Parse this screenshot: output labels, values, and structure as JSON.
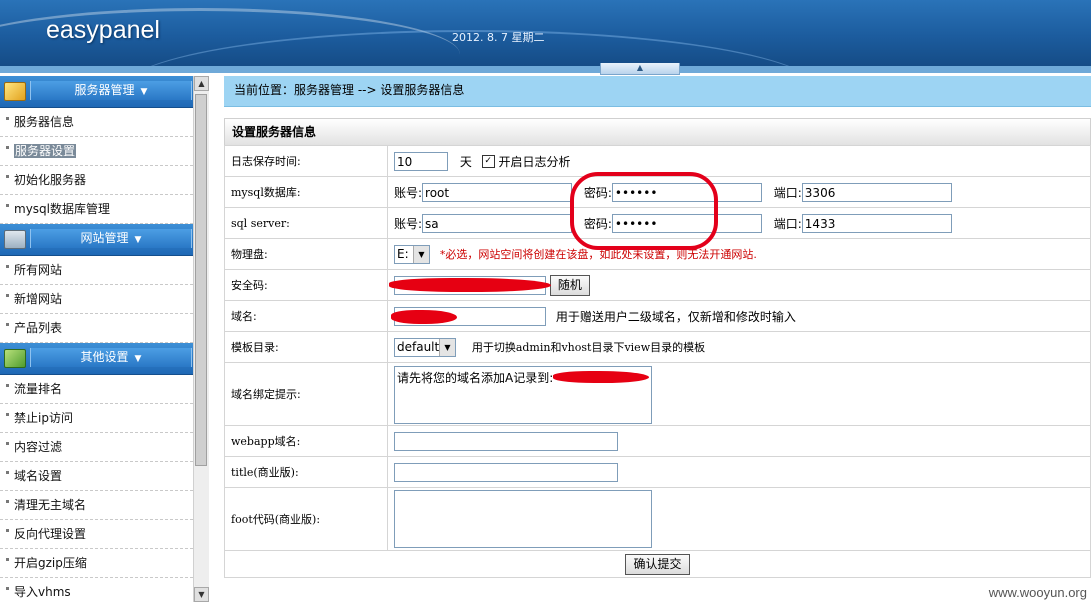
{
  "header": {
    "brand": "easypanel",
    "date": "2012. 8. 7  星期二",
    "collapse_icon": "chevron-up-icon"
  },
  "sidebar": {
    "sections": [
      {
        "title": "服务器管理",
        "icon": "folder-icon",
        "items": [
          "服务器信息",
          "服务器设置",
          "初始化服务器",
          "mysql数据库管理"
        ]
      },
      {
        "title": "网站管理",
        "icon": "monitor-icon",
        "items": [
          "所有网站",
          "新增网站",
          "产品列表"
        ]
      },
      {
        "title": "其他设置",
        "icon": "tools-icon",
        "items": [
          "流量排名",
          "禁止ip访问",
          "内容过滤",
          "域名设置",
          "清理无主域名",
          "反向代理设置",
          "开启gzip压缩",
          "导入vhms"
        ]
      }
    ],
    "active_item": "服务器设置"
  },
  "breadcrumb": "当前位置：服务器管理 --> 设置服务器信息",
  "panel": {
    "title": "设置服务器信息",
    "log": {
      "label": "日志保存时间:",
      "value": "10",
      "unit": "天",
      "checkbox_label": "开启日志分析",
      "checked": true
    },
    "mysql": {
      "label": "mysql数据库:",
      "account_label": "账号:",
      "account": "root",
      "password_label": "密码:",
      "password": "••••••",
      "port_label": "端口:",
      "port": "3306"
    },
    "sqlserver": {
      "label": "sql server:",
      "account_label": "账号:",
      "account": "sa",
      "password_label": "密码:",
      "password": "••••••",
      "port_label": "端口:",
      "port": "1433"
    },
    "disk": {
      "label": "物理盘:",
      "value": "E:",
      "note": "*必选，网站空间将创建在该盘，如此处未设置，则无法开通网站."
    },
    "security": {
      "label": "安全码:",
      "button": "随机"
    },
    "domain": {
      "label": "域名:",
      "note": "用于赠送用户二级域名，仅新增和修改时输入"
    },
    "template": {
      "label": "模板目录:",
      "value": "default",
      "note": "用于切换admin和vhost目录下view目录的模板"
    },
    "bind_tip": {
      "label": "域名绑定提示:",
      "value": "请先将您的域名添加A记录到:"
    },
    "webapp": {
      "label": "webapp域名:",
      "value": ""
    },
    "title_field": {
      "label": "title(商业版):",
      "value": ""
    },
    "foot": {
      "label": "foot代码(商业版):",
      "value": ""
    },
    "submit": "确认提交"
  },
  "watermark": "www.wooyun.org",
  "colors": {
    "header": "#1c5c9e",
    "breadcrumb_bg": "#9dd4f3",
    "annotation": "#e3001b",
    "required_note": "#cc0000"
  }
}
